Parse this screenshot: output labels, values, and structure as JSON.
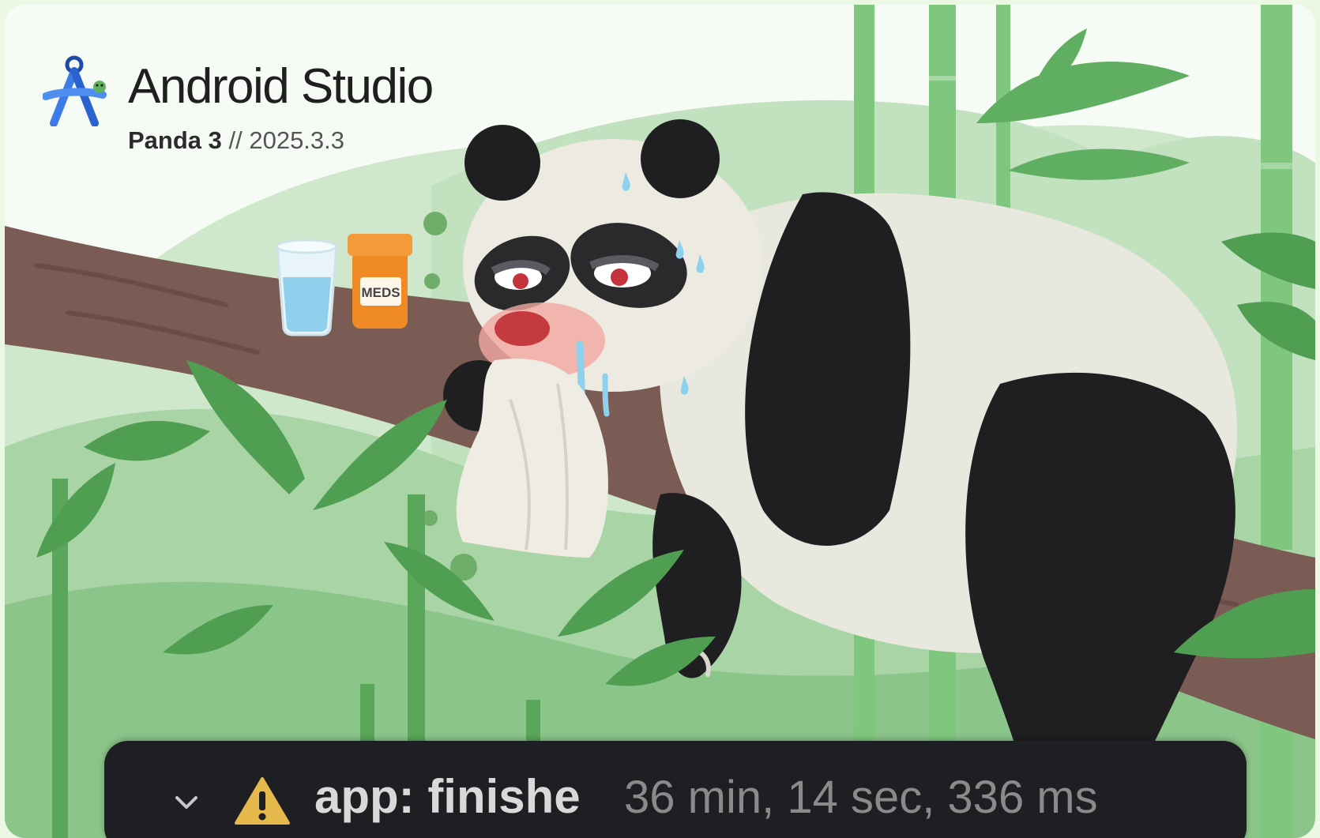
{
  "splash": {
    "app_name": "Android Studio",
    "release_name": "Panda 3",
    "separator": " // ",
    "version": "2025.3.3",
    "bottle_label": "MEDS"
  },
  "build_status": {
    "collapse_icon": "chevron-down-icon",
    "status_icon": "warning-triangle-icon",
    "label": "app: finishe",
    "duration": "36 min, 14 sec, 336 ms"
  },
  "colors": {
    "background": "#f7fbf5",
    "bamboo": "#6fbb6f",
    "branch": "#7b5c54",
    "bar": "#1e1f22",
    "warning": "#e6b94c",
    "meds_bottle": "#f08a24"
  }
}
